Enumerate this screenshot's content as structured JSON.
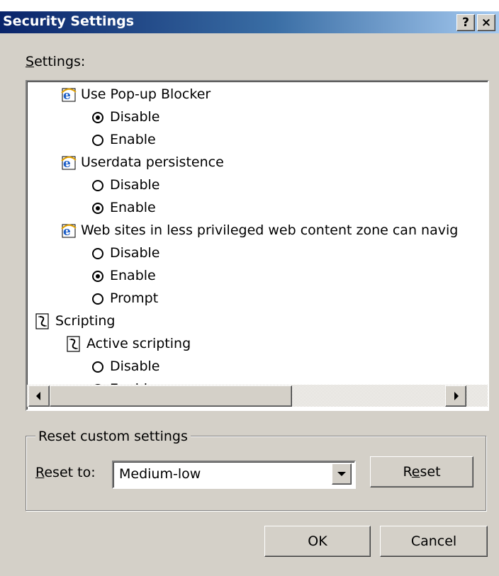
{
  "window": {
    "title": "Security Settings",
    "help_label": "?",
    "close_label": "×"
  },
  "settings_label": {
    "mnemonic": "S",
    "rest": "ettings:"
  },
  "tree": [
    {
      "kind": "ie",
      "label": "Use Pop-up Blocker"
    },
    {
      "kind": "radio",
      "label": "Disable",
      "selected": true
    },
    {
      "kind": "radio",
      "label": "Enable",
      "selected": false
    },
    {
      "kind": "ie",
      "label": "Userdata persistence"
    },
    {
      "kind": "radio",
      "label": "Disable",
      "selected": false
    },
    {
      "kind": "radio",
      "label": "Enable",
      "selected": true
    },
    {
      "kind": "ie",
      "label": "Web sites in less privileged web content zone can navig"
    },
    {
      "kind": "radio",
      "label": "Disable",
      "selected": false
    },
    {
      "kind": "radio",
      "label": "Enable",
      "selected": true
    },
    {
      "kind": "radio",
      "label": "Prompt",
      "selected": false
    },
    {
      "kind": "category",
      "label": "Scripting"
    },
    {
      "kind": "script",
      "label": "Active scripting"
    },
    {
      "kind": "radio",
      "label": "Disable",
      "selected": false
    },
    {
      "kind": "radio",
      "label": "Enable",
      "selected": true
    }
  ],
  "reset_group": {
    "legend": "Reset custom settings",
    "reset_to_mnemonic": "R",
    "reset_to_rest": "eset to:",
    "selected_level": "Medium-low",
    "reset_button_pre": "R",
    "reset_button_mnemonic": "e",
    "reset_button_post": "set"
  },
  "buttons": {
    "ok": "OK",
    "cancel": "Cancel"
  },
  "colors": {
    "dialog_bg": "#d4d0c8",
    "title_gradient_start": "#0a246a",
    "title_gradient_end": "#a6caf0"
  }
}
